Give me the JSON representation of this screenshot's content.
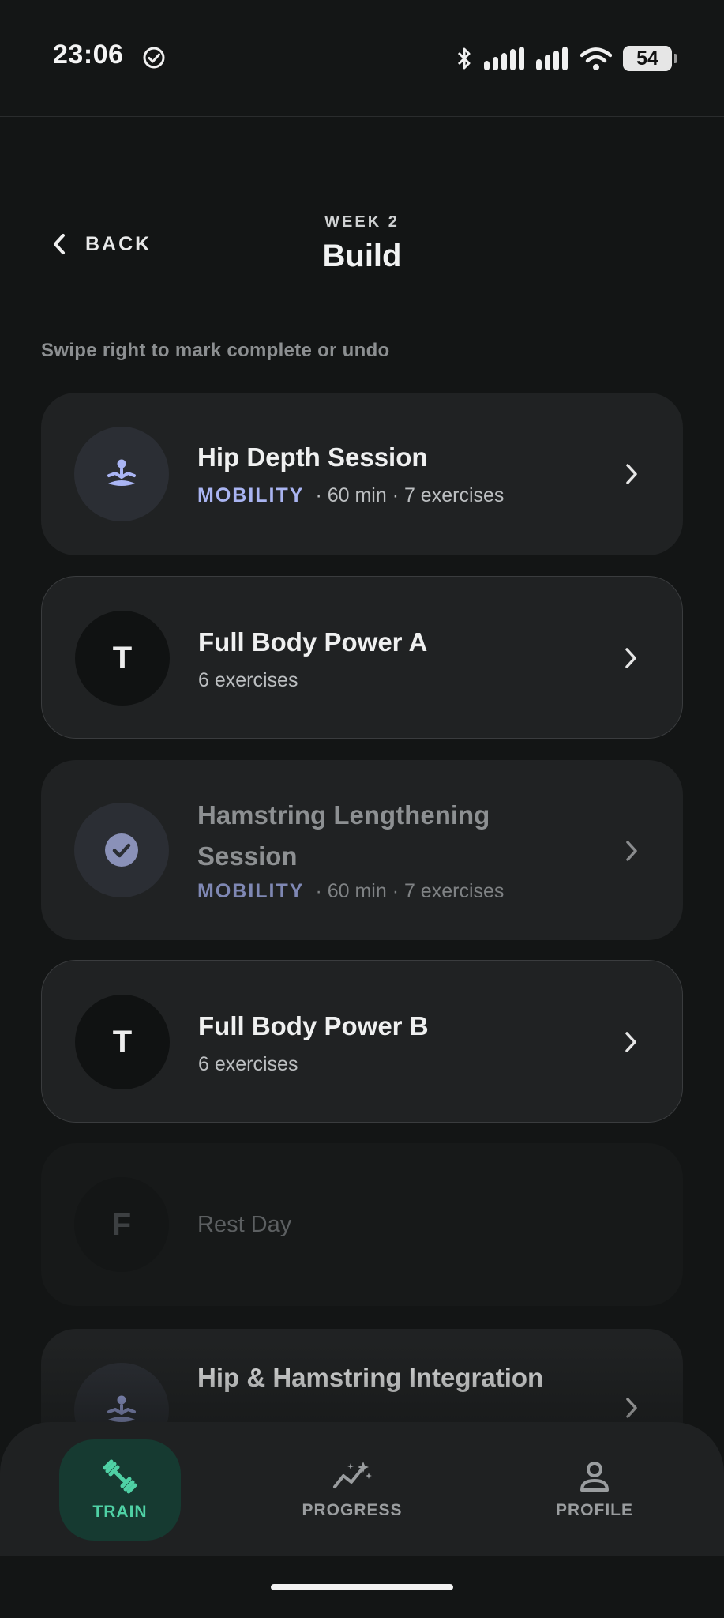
{
  "status_bar": {
    "time": "23:06",
    "battery": "54"
  },
  "header": {
    "back_label": "BACK",
    "week": "WEEK 2",
    "title": "Build"
  },
  "hint": "Swipe right to mark complete or undo",
  "cards": [
    {
      "title": "Hip Depth Session",
      "tag": "MOBILITY",
      "meta": "· 60 min · 7 exercises",
      "icon": "meditation-icon",
      "state": "normal"
    },
    {
      "title": "Full Body Power A",
      "avatar_letter": "T",
      "meta": "6 exercises",
      "state": "normal"
    },
    {
      "title": "Hamstring Lengthening Session",
      "tag": "MOBILITY",
      "meta": "· 60 min · 7 exercises",
      "icon": "check-circle-icon",
      "state": "completed"
    },
    {
      "title": "Full Body Power B",
      "avatar_letter": "T",
      "meta": "6 exercises",
      "state": "normal"
    },
    {
      "title": "Rest Day",
      "avatar_letter": "F",
      "state": "rest"
    },
    {
      "title": "Hip & Hamstring Integration",
      "icon": "meditation-icon",
      "state": "normal"
    }
  ],
  "nav": {
    "items": [
      {
        "label": "TRAIN",
        "icon": "dumbbell-icon",
        "active": true
      },
      {
        "label": "PROGRESS",
        "icon": "progress-chart-icon",
        "active": false
      },
      {
        "label": "PROFILE",
        "icon": "profile-icon",
        "active": false
      }
    ]
  },
  "colors": {
    "accent": "#4fd1a5",
    "mobility": "#a9b4f1",
    "background": "#131515",
    "card": "#202223"
  }
}
